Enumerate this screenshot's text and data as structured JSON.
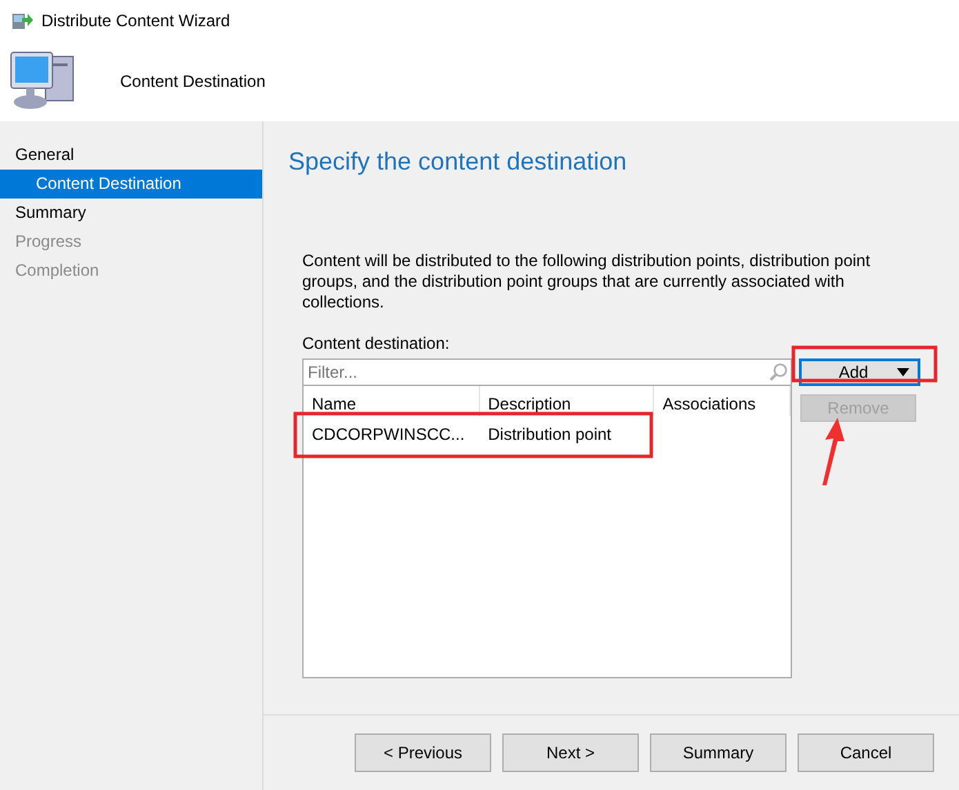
{
  "window": {
    "title": "Distribute Content Wizard"
  },
  "header": {
    "page": "Content Destination"
  },
  "steps": [
    {
      "label": "General",
      "selected": false,
      "disabled": false,
      "children": [
        {
          "label": "Content Destination",
          "selected": true,
          "disabled": false
        }
      ]
    },
    {
      "label": "Summary",
      "selected": false,
      "disabled": false
    },
    {
      "label": "Progress",
      "selected": false,
      "disabled": true
    },
    {
      "label": "Completion",
      "selected": false,
      "disabled": true
    }
  ],
  "heading": "Specify the content destination",
  "description": "Content will be distributed to the following distribution points, distribution point groups, and the distribution point groups that are currently associated with collections.",
  "destination_label": "Content destination:",
  "filter": {
    "placeholder": "Filter..."
  },
  "table": {
    "columns": [
      "Name",
      "Description",
      "Associations"
    ],
    "rows": [
      [
        "CDCORPWINSCC...",
        "Distribution point",
        ""
      ]
    ]
  },
  "side_buttons": [
    {
      "label": "Add",
      "kind": "dropdown",
      "disabled": false
    },
    {
      "label": "Remove",
      "kind": "plain",
      "disabled": true
    }
  ],
  "buttons": [
    {
      "label": "< Previous"
    },
    {
      "label": "Next >"
    },
    {
      "label": "Summary"
    },
    {
      "label": "Cancel"
    }
  ]
}
